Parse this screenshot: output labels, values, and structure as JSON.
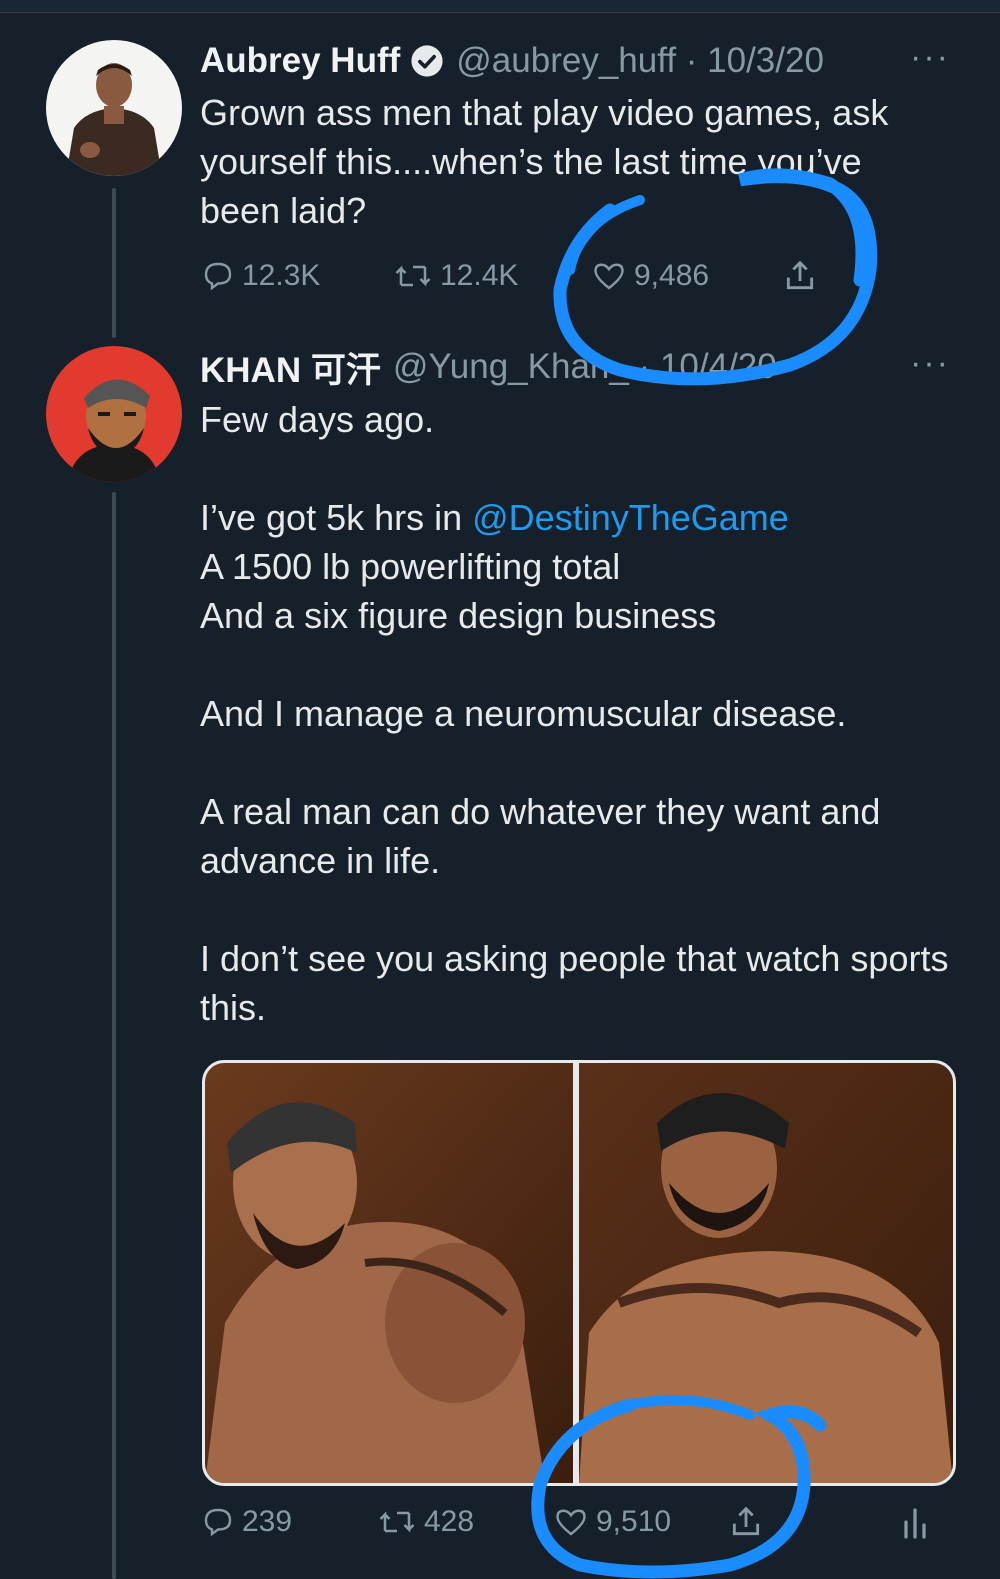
{
  "colors": {
    "background": "#15202b",
    "text": "#e7e9ea",
    "secondary": "#8899a6",
    "link": "#1d9bf0",
    "annotation": "#1a8cff"
  },
  "tweets": [
    {
      "name": "Aubrey Huff",
      "verified": true,
      "handle_date": "@aubrey_huff · 10/3/20",
      "more": "···",
      "text": "Grown ass men that play video games, ask yourself this....when’s the last time you’ve been laid?",
      "replies": "12.3K",
      "retweets": "12.4K",
      "likes": "9,486"
    },
    {
      "name": "KHAN 可汗",
      "handle_date": "@Yung_Khan_ · 10/4/20",
      "more": "···",
      "text_line1": "Few days ago.",
      "text_line2_prefix": "I’ve got 5k hrs in ",
      "mention": "@DestinyTheGame",
      "text_rest": "A 1500 lb powerlifting total\nAnd a six figure design business\n\nAnd I manage a neuromuscular disease.\n\nA real man can do whatever they want and advance in life.\n\nI don’t see you asking people that watch sports this.",
      "replies": "239",
      "retweets": "428",
      "likes": "9,510"
    }
  ]
}
